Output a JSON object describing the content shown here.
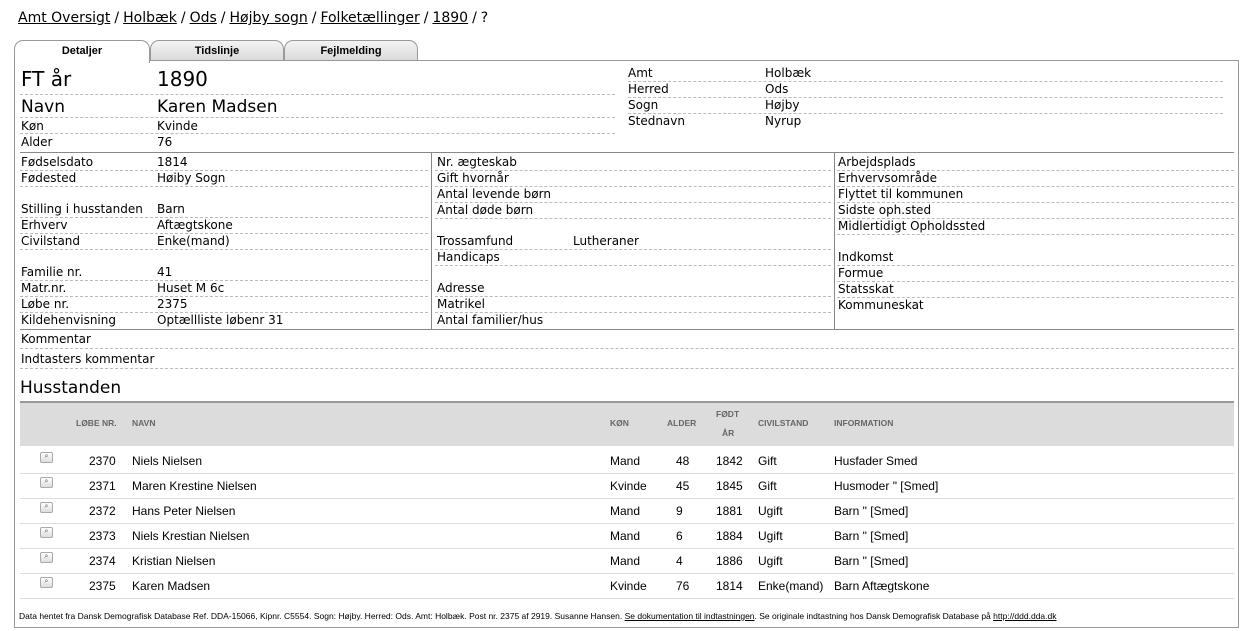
{
  "breadcrumb": [
    "Amt Oversigt",
    "Holbæk",
    "Ods",
    "Højby sogn",
    "Folketællinger",
    "1890",
    "?"
  ],
  "breadcrumb_sep": "/",
  "tabs": [
    "Detaljer",
    "Tidslinje",
    "Fejlmelding"
  ],
  "header": {
    "ft_label": "FT år",
    "ft_value": "1890",
    "navn_label": "Navn",
    "navn_value": "Karen Madsen",
    "kon_label": "Køn",
    "kon_value": "Kvinde",
    "alder_label": "Alder",
    "alder_value": "76",
    "amt_label": "Amt",
    "amt_value": "Holbæk",
    "herred_label": "Herred",
    "herred_value": "Ods",
    "sogn_label": "Sogn",
    "sogn_value": "Højby",
    "sted_label": "Stednavn",
    "sted_value": "Nyrup"
  },
  "col1": {
    "fodselsdato_l": "Fødselsdato",
    "fodselsdato_v": "1814",
    "fodested_l": "Fødested",
    "fodested_v": "Høiby Sogn",
    "stilling_l": "Stilling i husstanden",
    "stilling_v": "Barn",
    "erhverv_l": "Erhverv",
    "erhverv_v": "Aftægtskone",
    "civil_l": "Civilstand",
    "civil_v": "Enke(mand)",
    "familie_l": "Familie nr.",
    "familie_v": "41",
    "matr_l": "Matr.nr.",
    "matr_v": "Huset M 6c",
    "lobe_l": "Løbe nr.",
    "lobe_v": "2375",
    "kilde_l": "Kildehenvisning",
    "kilde_v": "Optællliste løbenr 31"
  },
  "col2": {
    "aegteskab": "Nr. ægteskab",
    "gift": "Gift hvornår",
    "levende": "Antal levende børn",
    "dode": "Antal døde børn",
    "tros_l": "Trossamfund",
    "tros_v": "Lutheraner",
    "handicaps": "Handicaps",
    "adresse": "Adresse",
    "matrikel": "Matrikel",
    "familier": "Antal familier/hus"
  },
  "col3": {
    "arbejdsplads": "Arbejdsplads",
    "erhvervsomrade": "Erhvervsområde",
    "flyttet": "Flyttet til kommunen",
    "sidste": "Sidste oph.sted",
    "midlertidigt": "Midlertidigt Opholdssted",
    "indkomst": "Indkomst",
    "formue": "Formue",
    "statsskat": "Statsskat",
    "kommuneskat": "Kommuneskat"
  },
  "kommentar": "Kommentar",
  "indtaster": "Indtasters kommentar",
  "husstanden": "Husstanden",
  "table": {
    "headers": {
      "lobe": "LØBE NR.",
      "navn": "NAVN",
      "kon": "KØN",
      "alder": "ALDER",
      "fodt1": "FØDT",
      "fodt2": "ÅR",
      "civil": "CIVILSTAND",
      "info": "INFORMATION"
    },
    "rows": [
      {
        "lobe": "2370",
        "navn": "Niels Nielsen",
        "kon": "Mand",
        "alder": "48",
        "fodt": "1842",
        "civil": "Gift",
        "info": "Husfader Smed"
      },
      {
        "lobe": "2371",
        "navn": "Maren Krestine Nielsen",
        "kon": "Kvinde",
        "alder": "45",
        "fodt": "1845",
        "civil": "Gift",
        "info": "Husmoder \" [Smed]"
      },
      {
        "lobe": "2372",
        "navn": "Hans Peter Nielsen",
        "kon": "Mand",
        "alder": "9",
        "fodt": "1881",
        "civil": "Ugift",
        "info": "Barn \" [Smed]"
      },
      {
        "lobe": "2373",
        "navn": "Niels Krestian Nielsen",
        "kon": "Mand",
        "alder": "6",
        "fodt": "1884",
        "civil": "Ugift",
        "info": "Barn \" [Smed]"
      },
      {
        "lobe": "2374",
        "navn": "Kristian Nielsen",
        "kon": "Mand",
        "alder": "4",
        "fodt": "1886",
        "civil": "Ugift",
        "info": "Barn \" [Smed]"
      },
      {
        "lobe": "2375",
        "navn": "Karen Madsen",
        "kon": "Kvinde",
        "alder": "76",
        "fodt": "1814",
        "civil": "Enke(mand)",
        "info": "Barn Aftægtskone"
      }
    ]
  },
  "footer": {
    "text": "Data hentet fra Dansk Demografisk Database Ref. DDA-15066, Kipnr. C5554. Sogn: Højby. Herred: Ods. Amt: Holbæk. Post nr. 2375 af 2919. Susanne Hansen.",
    "link1": "Se dokumentation til indtastningen",
    "text2": ". Se originale indtastning hos Dansk Demografisk Database på",
    "link2": "http://ddd.dda.dk"
  },
  "icons": {
    "row_view": "magnifier-icon"
  }
}
